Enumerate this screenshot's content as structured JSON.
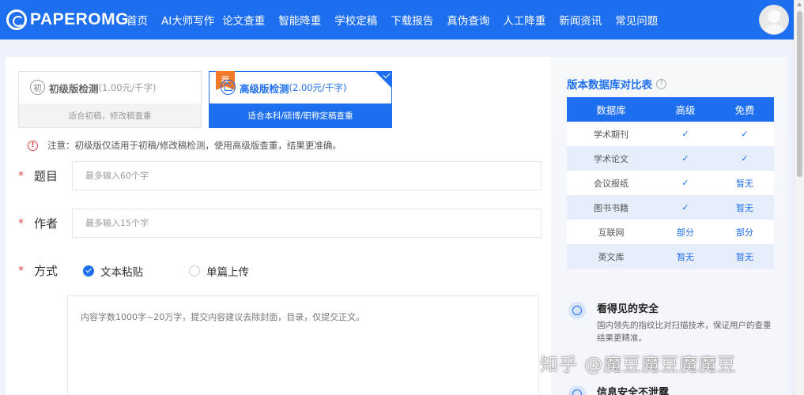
{
  "header": {
    "logo_text": "PAPEROMG",
    "nav": [
      "首页",
      "AI大师写作",
      "论文查重",
      "智能降重",
      "学校定稿",
      "下载报告",
      "真伪查询",
      "人工降重",
      "新闻资讯",
      "常见问题"
    ]
  },
  "versions": {
    "basic": {
      "icon_text": "初",
      "name": "初级版检测",
      "price": "(1.00元/千字)",
      "desc": "适合初稿，修改稿查重"
    },
    "advanced": {
      "badge": "荐",
      "name": "高级版检测",
      "price": "(2.00元/千字)",
      "desc": "适合本科/硕博/职称定稿查重"
    }
  },
  "notice": {
    "icon": "!",
    "text": "注意：初级版仅适用于初稿/修改稿检测，使用高级版查重，结果更准确。"
  },
  "form": {
    "required_mark": "*",
    "title_label": "题目",
    "title_placeholder": "最多输入60个字",
    "author_label": "作者",
    "author_placeholder": "最多输入15个字",
    "method_label": "方式",
    "method_options": [
      "文本粘贴",
      "单篇上传"
    ],
    "method_selected": 0,
    "content_placeholder": "内容字数1000字~20万字，提交内容建议去除封面，目录，仅提交正文。"
  },
  "compare": {
    "title": "版本数据库对比表",
    "help_icon": "?",
    "headers": [
      "数据库",
      "高级",
      "免费"
    ],
    "rows": [
      [
        "学术期刊",
        "✓",
        "✓"
      ],
      [
        "学术论文",
        "✓",
        "✓"
      ],
      [
        "会议报纸",
        "✓",
        "暂无"
      ],
      [
        "图书书籍",
        "✓",
        "暂无"
      ],
      [
        "互联网",
        "部分",
        "部分"
      ],
      [
        "英文库",
        "暂无",
        "暂无"
      ]
    ]
  },
  "features": [
    {
      "title": "看得见的安全",
      "desc": "国内领先的指纹比对扫描技术，保证用户的查重结果更精准。"
    },
    {
      "title": "信息安全不泄露",
      "desc": ""
    }
  ],
  "watermark": "知乎 @魔豆魔豆魔魔豆",
  "colors": {
    "primary": "#1e6ef0",
    "badge": "#f07a2a",
    "required": "#e64545"
  }
}
